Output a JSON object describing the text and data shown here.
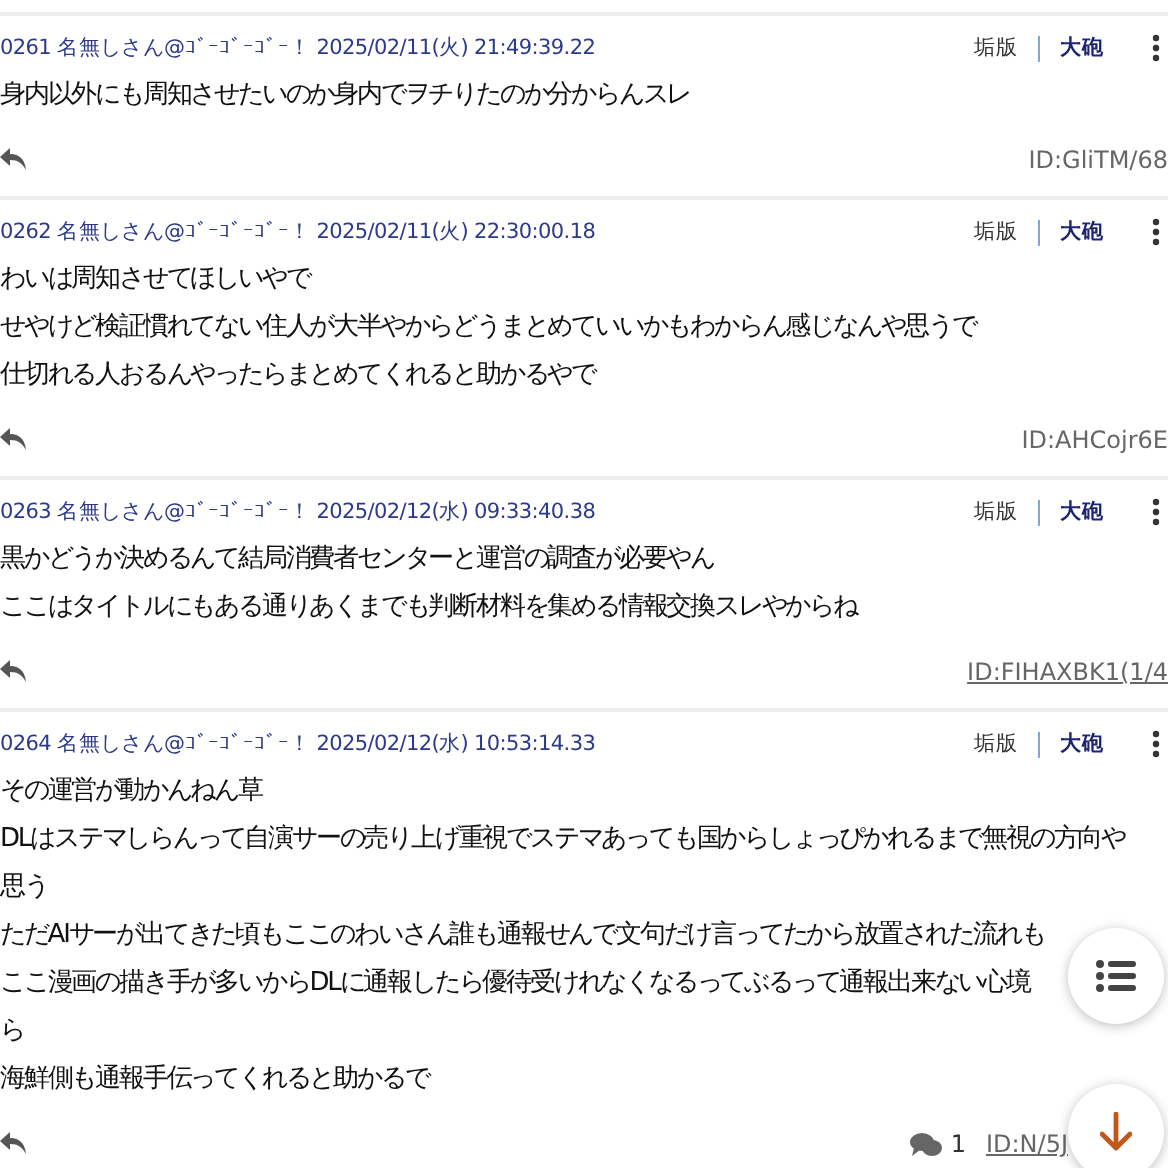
{
  "posts": [
    {
      "number": "0261",
      "name": "名無しさん@ｺﾞｰｺﾞｰｺﾞｰ！",
      "date": "2025/02/11(火) 21:49:39.22",
      "actions": [
        "垢版",
        "大砲"
      ],
      "lines": [
        "身内以外にも周知させたいのか身内でヲチりたのか分からんスレ"
      ],
      "id": "ID:GliTM/68",
      "id_link": false
    },
    {
      "number": "0262",
      "name": "名無しさん@ｺﾞｰｺﾞｰｺﾞｰ！",
      "date": "2025/02/11(火) 22:30:00.18",
      "actions": [
        "垢版",
        "大砲"
      ],
      "lines": [
        "わいは周知させてほしいやで",
        "せやけど検証慣れてない住人が大半やからどうまとめていいかもわからん感じなんや思うで",
        "仕切れる人おるんやったらまとめてくれると助かるやで"
      ],
      "id": "ID:AHCojr6E",
      "id_link": false
    },
    {
      "number": "0263",
      "name": "名無しさん@ｺﾞｰｺﾞｰｺﾞｰ！",
      "date": "2025/02/12(水) 09:33:40.38",
      "actions": [
        "垢版",
        "大砲"
      ],
      "lines": [
        "黒かどうか決めるんて結局消費者センターと運営の調査が必要やん",
        "ここはタイトルにもある通りあくまでも判断材料を集める情報交換スレやからね"
      ],
      "id": "ID:FIHAXBK1(1/4",
      "id_link": true
    },
    {
      "number": "0264",
      "name": "名無しさん@ｺﾞｰｺﾞｰｺﾞｰ！",
      "date": "2025/02/12(水) 10:53:14.33",
      "actions": [
        "垢版",
        "大砲"
      ],
      "lines": [
        "その運営が動かんねん草",
        "DLはステマしらんって自演サーの売り上げ重視でステマあっても国からしょっぴかれるまで無視の方向や",
        "思う",
        "ただAIサーが出てきた頃もここのわいさん誰も通報せんで文句だけ言ってたから放置された流れも",
        "ここ漫画の描き手が多いからDLに通報したら優待受けれなくなるってぶるって通報出来ない心境",
        "ら",
        "海鮮側も通報手伝ってくれると助かるで"
      ],
      "replies": "1",
      "id": "ID:N/5J",
      "id_link": true
    }
  ]
}
